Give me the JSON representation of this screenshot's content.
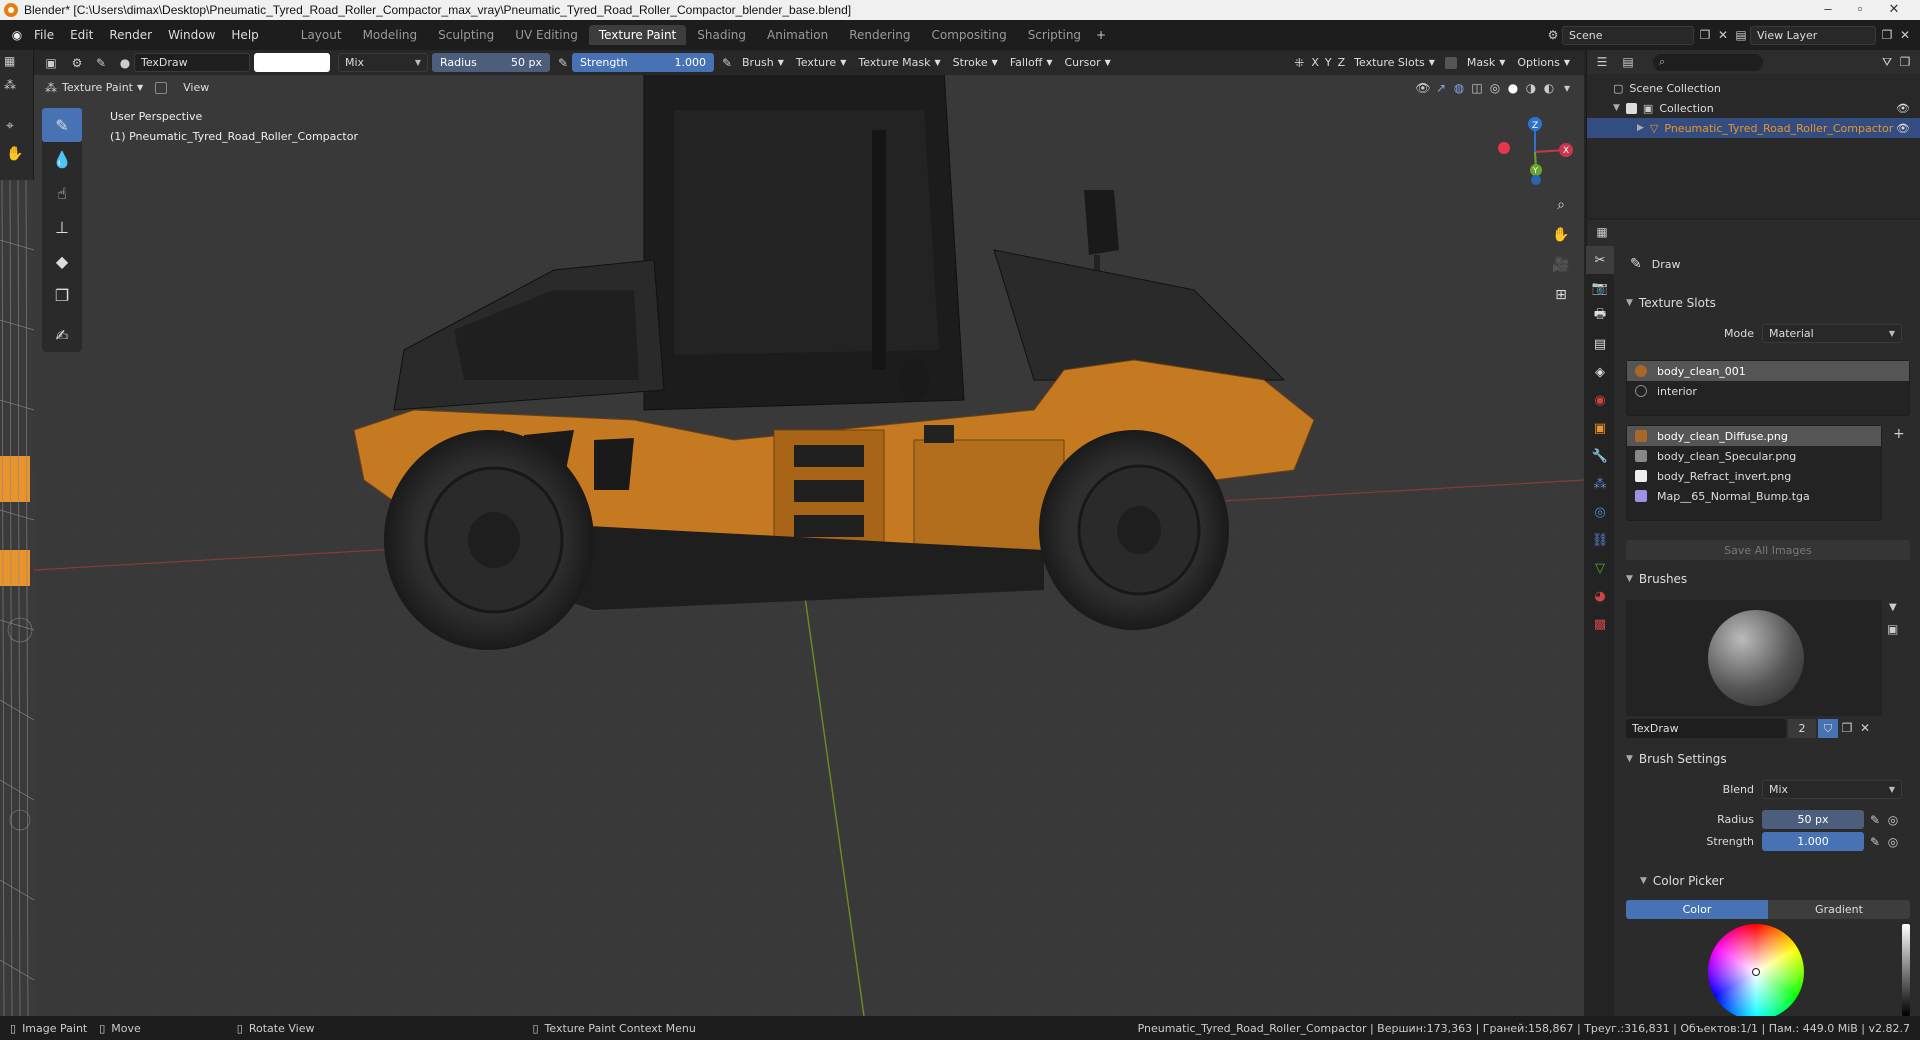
{
  "window": {
    "title": "Blender* [C:\\Users\\dimax\\Desktop\\Pneumatic_Tyred_Road_Roller_Compactor_max_vray\\Pneumatic_Tyred_Road_Roller_Compactor_blender_base.blend]"
  },
  "menu": [
    "File",
    "Edit",
    "Render",
    "Window",
    "Help"
  ],
  "workspaces": [
    "Layout",
    "Modeling",
    "Sculpting",
    "UV Editing",
    "Texture Paint",
    "Shading",
    "Animation",
    "Rendering",
    "Compositing",
    "Scripting"
  ],
  "active_workspace": "Texture Paint",
  "scene": {
    "scene_name": "Scene",
    "view_layer": "View Layer"
  },
  "header": {
    "brush_name": "TexDraw",
    "blend_mode": "Mix",
    "radius_label": "Radius",
    "radius_value": "50 px",
    "strength_label": "Strength",
    "strength_value": "1.000",
    "menus": [
      "Brush",
      "Texture",
      "Texture Mask",
      "Stroke",
      "Falloff",
      "Cursor"
    ],
    "axes": [
      "X",
      "Y",
      "Z"
    ],
    "texture_slots": "Texture Slots",
    "mask": "Mask",
    "options": "Options"
  },
  "header2": {
    "mode": "Texture Paint",
    "view": "View"
  },
  "viewport": {
    "perspective": "User Perspective",
    "object_label": "(1) Pneumatic_Tyred_Road_Roller_Compactor",
    "gizmo_axes": [
      "Z",
      "Y",
      "X"
    ]
  },
  "outliner": {
    "scene_collection": "Scene Collection",
    "collection": "Collection",
    "object": "Pneumatic_Tyred_Road_Roller_Compactor"
  },
  "props": {
    "tool_name": "Draw",
    "texture_slots": {
      "title": "Texture Slots",
      "mode_label": "Mode",
      "mode_value": "Material",
      "materials": [
        {
          "name": "body_clean_001",
          "selected": true
        },
        {
          "name": "interior",
          "selected": false
        }
      ],
      "images": [
        {
          "name": "body_clean_Diffuse.png",
          "selected": true,
          "color": "#a8672b"
        },
        {
          "name": "body_clean_Specular.png",
          "selected": false,
          "color": "#888888"
        },
        {
          "name": "body_Refract_invert.png",
          "selected": false,
          "color": "#eeeeee"
        },
        {
          "name": "Map__65_Normal_Bump.tga",
          "selected": false,
          "color": "#9b92e8"
        }
      ],
      "save_all": "Save All Images"
    },
    "brushes": {
      "title": "Brushes",
      "brush_name": "TexDraw",
      "users": "2"
    },
    "brush_settings": {
      "title": "Brush Settings",
      "blend_label": "Blend",
      "blend_value": "Mix",
      "radius_label": "Radius",
      "radius_value": "50 px",
      "strength_label": "Strength",
      "strength_value": "1.000"
    },
    "color_picker": {
      "title": "Color Picker",
      "tab_color": "Color",
      "tab_gradient": "Gradient"
    }
  },
  "status": {
    "image_paint": "Image Paint",
    "move": "Move",
    "rotate": "Rotate View",
    "context_menu": "Texture Paint Context Menu",
    "stats": "Pneumatic_Tyred_Road_Roller_Compactor | Вершин:173,363 | Граней:158,867 | Треуг.:316,831 | Объектов:1/1 | Пам.: 449.0 MiB | v2.82.7"
  },
  "colors": {
    "accent": "#4772b3",
    "body_orange": "#c57a22",
    "selection_orange": "#e8932b"
  }
}
